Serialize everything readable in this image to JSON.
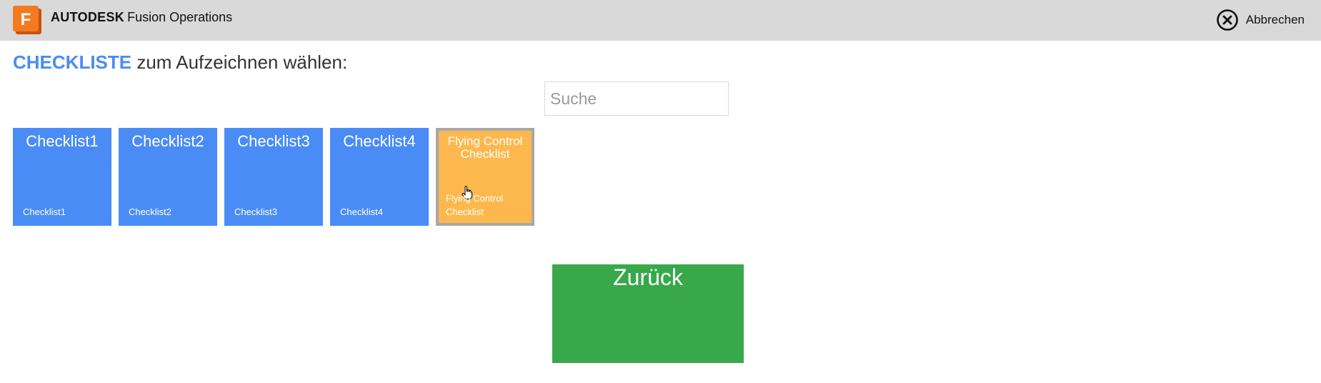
{
  "header": {
    "brand_bold": "AUTODESK",
    "brand_product": "Fusion Operations",
    "logo_icon": "fusion-f-logo-icon",
    "cancel_icon": "close-circle-icon",
    "cancel_label": "Abbrechen"
  },
  "heading": {
    "accent": "CHECKLISTE",
    "rest": " zum Aufzeichnen wählen:"
  },
  "search": {
    "placeholder": "Suche",
    "value": ""
  },
  "checklists": [
    {
      "title": "Checklist1",
      "subtitle": "Checklist1"
    },
    {
      "title": "Checklist2",
      "subtitle": "Checklist2"
    },
    {
      "title": "Checklist3",
      "subtitle": "Checklist3"
    },
    {
      "title": "Checklist4",
      "subtitle": "Checklist4"
    },
    {
      "title": "Flying Control Checklist",
      "subtitle": "Flying Control Checklist"
    }
  ],
  "back_button": {
    "label": "Zurück"
  },
  "colors": {
    "accent_blue": "#4a8cf6",
    "selected_orange": "#fdb84d",
    "back_green": "#38a84a",
    "header_gray": "#d9d9d9"
  }
}
